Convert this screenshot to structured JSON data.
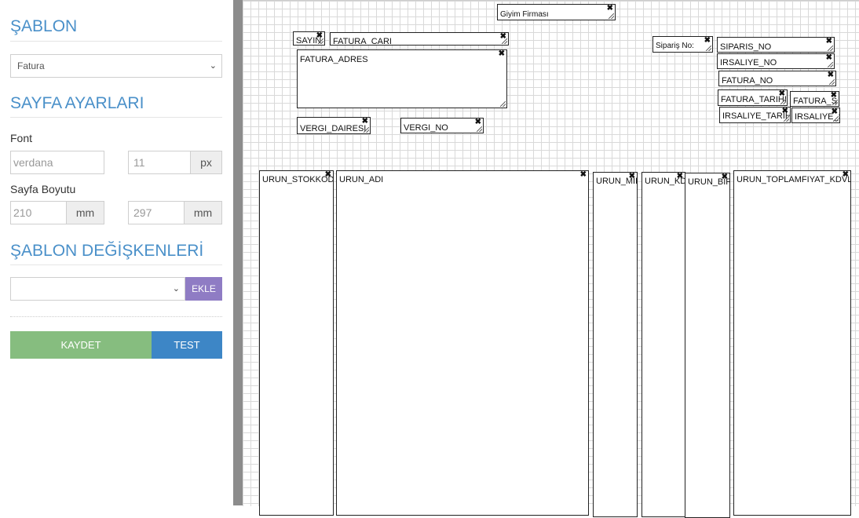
{
  "sidebar": {
    "template_title": "ŞABLON",
    "template_select": "Fatura",
    "page_settings_title": "SAYFA AYARLARI",
    "font_label": "Font",
    "font_placeholder": "verdana",
    "font_size_placeholder": "11",
    "font_size_unit": "px",
    "page_size_label": "Sayfa Boyutu",
    "width_placeholder": "210",
    "width_unit": "mm",
    "height_placeholder": "297",
    "height_unit": "mm",
    "variables_title": "ŞABLON DEĞİŞKENLERİ",
    "variables_select": "",
    "add_button": "EKLE",
    "save_button": "KAYDET",
    "test_button": "TEST"
  },
  "colors": {
    "title": "#4a90c9",
    "save": "#86bd7f",
    "test": "#3d86c6",
    "add": "#8f7cc4"
  },
  "canvas": {
    "fields": {
      "firm": "Giyim Firması",
      "sayin": "SAYIN",
      "fatura_cari": "FATURA_CARI",
      "fatura_adres": "FATURA_ADRES",
      "vergi_dairesi": "VERGI_DAIRESI",
      "vergi_no": "VERGI_NO",
      "siparis_label": "Sipariş No:",
      "siparis_no": "SIPARIS_NO",
      "irsaliye_no": "IRSALIYE_NO",
      "fatura_no": "FATURA_NO",
      "fatura_tarihi": "FATURA_TARIHI",
      "fatura_s": "FATURA_S",
      "irsaliye_tarihi": "IRSALIYE_TARIHI",
      "irsaliye_s": "IRSALIYE_S"
    },
    "columns": {
      "stokkod": "URUN_STOKKODU",
      "adi": "URUN_ADI",
      "miktar": "URUN_MIKTAR",
      "kdv": "URUN_KDV",
      "birim": "URUN_BIRIM",
      "toplam": "URUN_TOPLAMFIYAT_KDVLI"
    }
  }
}
